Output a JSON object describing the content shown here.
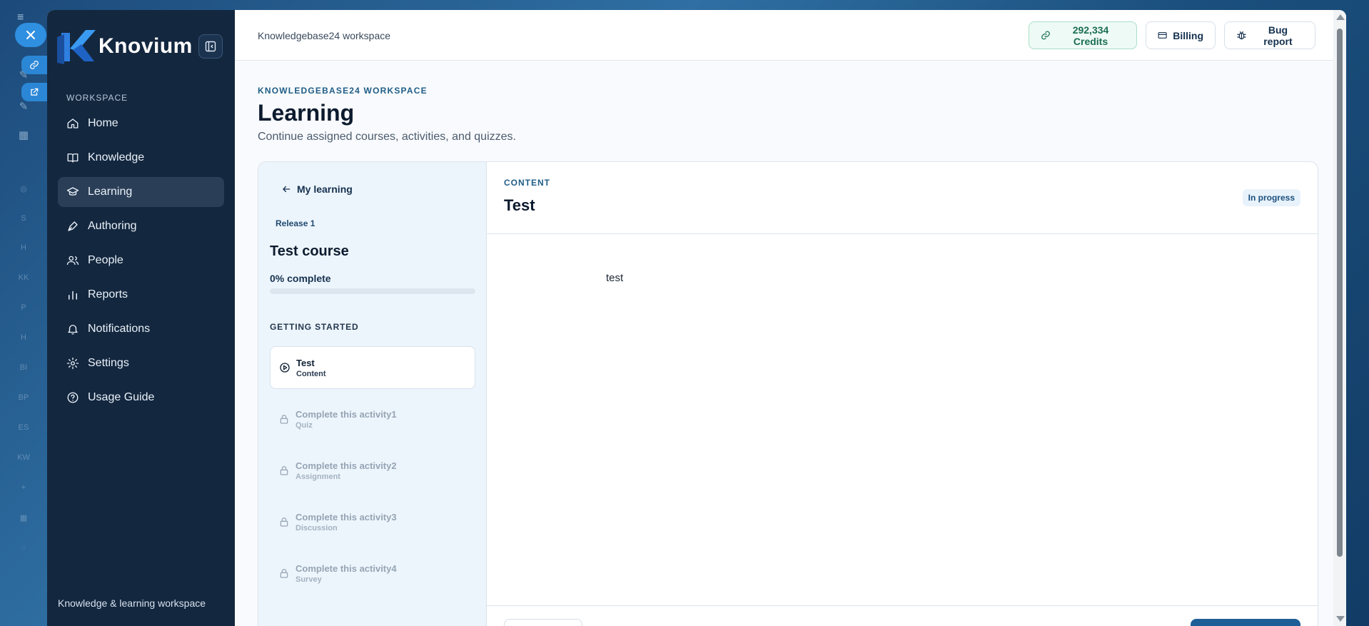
{
  "app": {
    "brand": "Knovium",
    "colors": {
      "sidebar": "#13273f",
      "accent": "#1e5e97",
      "credits": "#1a6e52"
    }
  },
  "sidebar": {
    "section_label": "WORKSPACE",
    "items": [
      {
        "label": "Home",
        "icon": "home-icon"
      },
      {
        "label": "Knowledge",
        "icon": "book-icon"
      },
      {
        "label": "Learning",
        "icon": "graduation-cap-icon",
        "active": true
      },
      {
        "label": "Authoring",
        "icon": "pen-tool-icon"
      },
      {
        "label": "People",
        "icon": "users-icon"
      },
      {
        "label": "Reports",
        "icon": "bar-chart-icon"
      },
      {
        "label": "Notifications",
        "icon": "bell-icon"
      },
      {
        "label": "Settings",
        "icon": "gear-icon"
      },
      {
        "label": "Usage Guide",
        "icon": "help-circle-icon"
      }
    ],
    "footer": "Knowledge & learning workspace"
  },
  "topbar": {
    "workspace_name": "Knowledgebase24 workspace",
    "credits": "292,334 Credits",
    "billing": "Billing",
    "bug_report": "Bug report"
  },
  "page": {
    "eyebrow": "KNOWLEDGEBASE24 WORKSPACE",
    "title": "Learning",
    "subtitle": "Continue assigned courses, activities, and quizzes."
  },
  "course": {
    "back_label": "My learning",
    "release": "Release 1",
    "title": "Test course",
    "progress_text": "0% complete",
    "progress": 0,
    "section": "GETTING STARTED",
    "lessons": [
      {
        "title": "Test",
        "type": "Content",
        "state": "active"
      },
      {
        "title": "Complete this activity1",
        "type": "Quiz",
        "state": "locked"
      },
      {
        "title": "Complete this activity2",
        "type": "Assignment",
        "state": "locked"
      },
      {
        "title": "Complete this activity3",
        "type": "Discussion",
        "state": "locked"
      },
      {
        "title": "Complete this activity4",
        "type": "Survey",
        "state": "locked"
      }
    ]
  },
  "content": {
    "eyebrow": "CONTENT",
    "title": "Test",
    "status": "In progress",
    "body": "test"
  }
}
